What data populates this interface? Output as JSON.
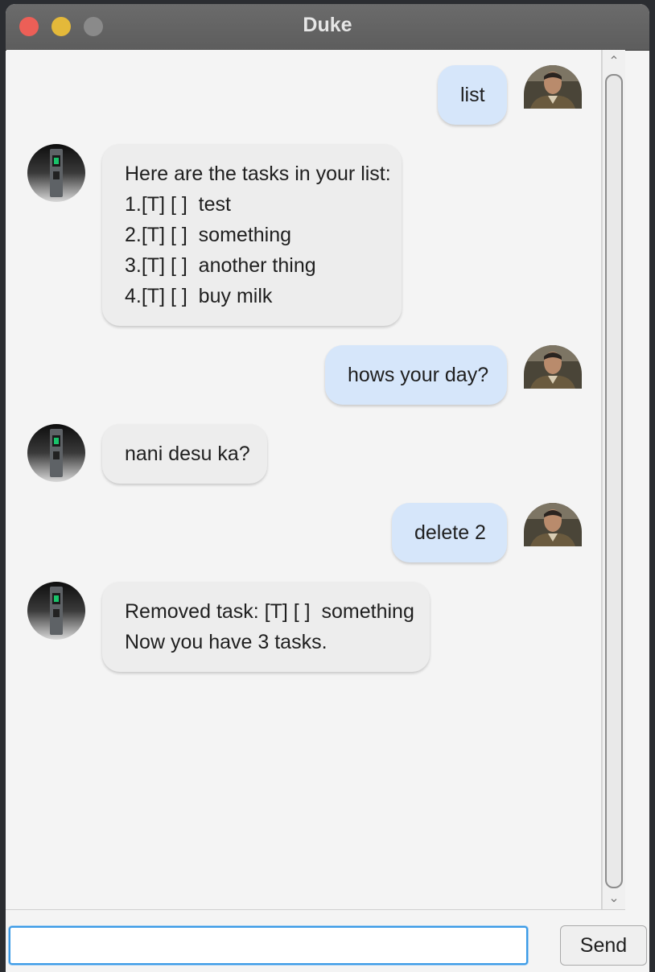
{
  "window": {
    "title": "Duke"
  },
  "messages": [
    {
      "sender": "user",
      "lines": [
        "list"
      ]
    },
    {
      "sender": "duke",
      "lines": [
        "Here are the tasks in your list:",
        "1.[T] [ ]  test",
        "2.[T] [ ]  something",
        "3.[T] [ ]  another thing",
        "4.[T] [ ]  buy milk"
      ]
    },
    {
      "sender": "user",
      "lines": [
        "hows your day?"
      ]
    },
    {
      "sender": "duke",
      "lines": [
        "nani desu ka?"
      ]
    },
    {
      "sender": "user",
      "lines": [
        "delete 2"
      ]
    },
    {
      "sender": "duke",
      "lines": [
        "Removed task: [T] [ ]  something",
        "Now you have 3 tasks."
      ]
    }
  ],
  "input": {
    "value": "",
    "placeholder": ""
  },
  "send_label": "Send",
  "icons": {
    "scroll_up": "chevron-up-icon",
    "scroll_down": "chevron-down-icon",
    "user_avatar": "user-avatar-photo",
    "duke_avatar": "duke-avatar-device"
  }
}
